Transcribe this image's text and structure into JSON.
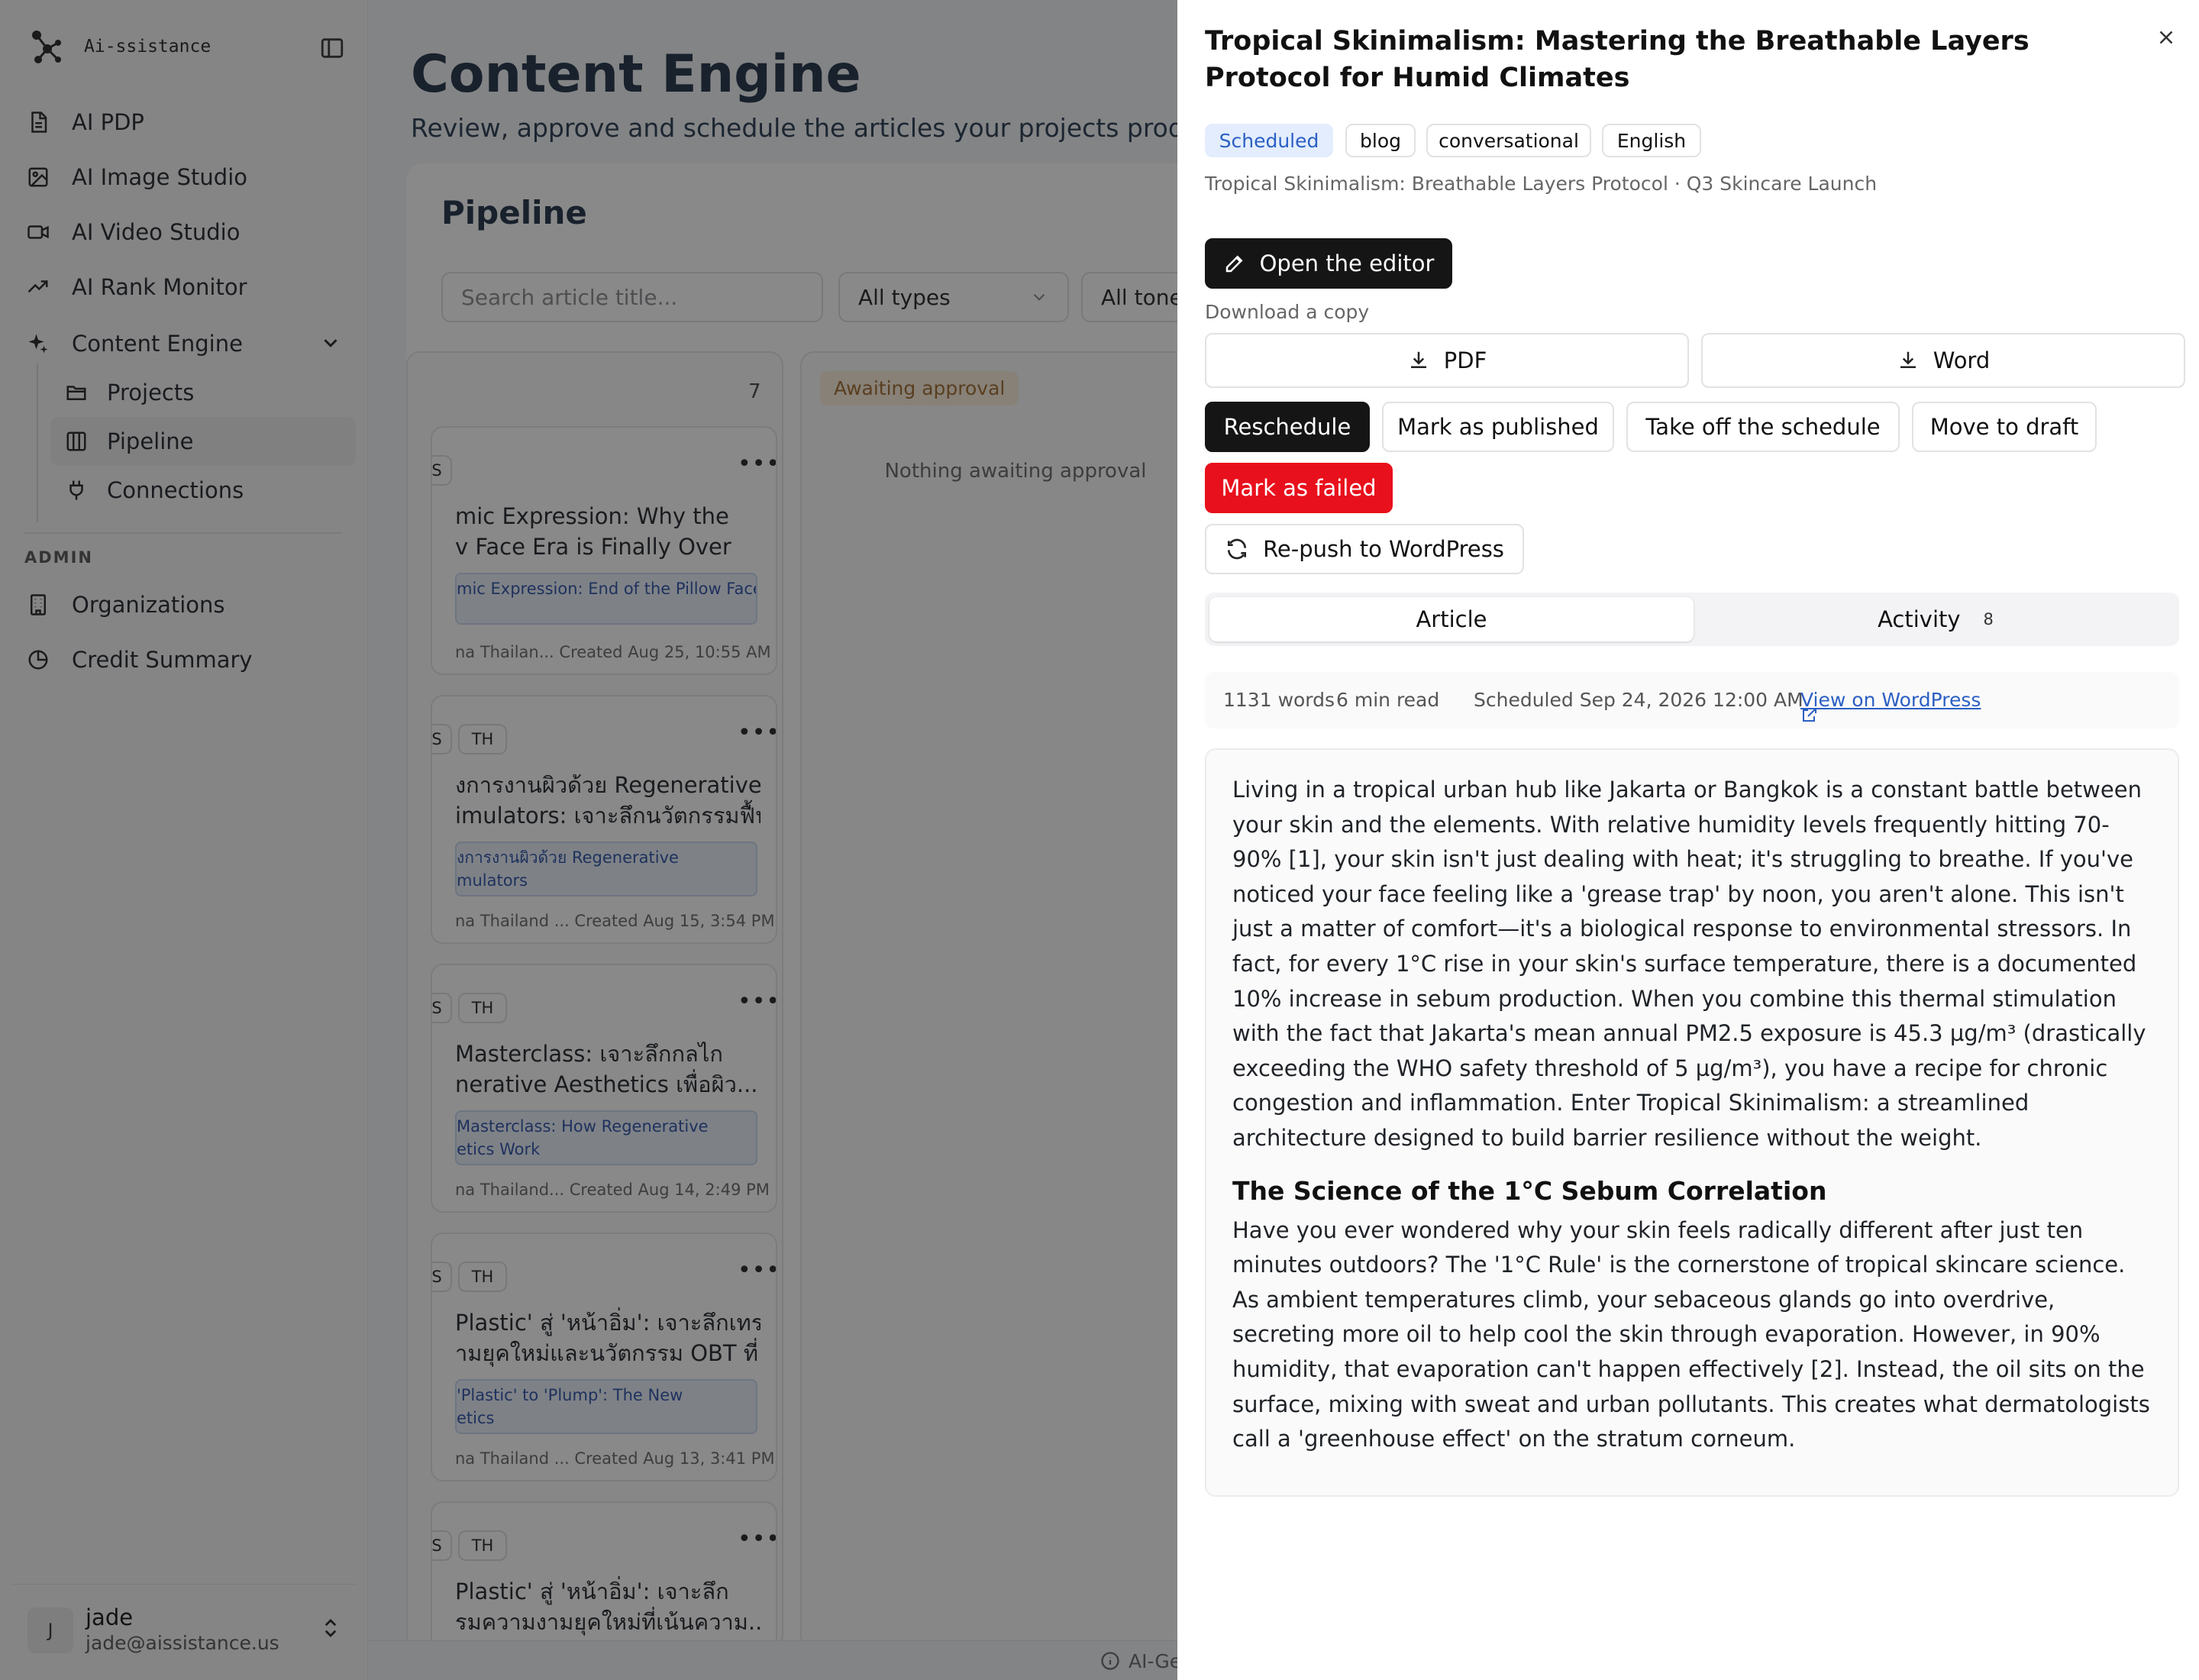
{
  "sidebar": {
    "brand": "Ai-ssistance",
    "nav": [
      {
        "label": "AI PDP",
        "icon": "document-icon"
      },
      {
        "label": "AI Image Studio",
        "icon": "image-icon"
      },
      {
        "label": "AI Video Studio",
        "icon": "video-icon"
      },
      {
        "label": "AI Rank Monitor",
        "icon": "trend-icon"
      },
      {
        "label": "Content Engine",
        "icon": "sparkle-icon"
      }
    ],
    "sub": [
      {
        "label": "Projects",
        "icon": "folder-icon"
      },
      {
        "label": "Pipeline",
        "icon": "columns-icon"
      },
      {
        "label": "Connections",
        "icon": "plug-icon"
      }
    ],
    "admin_label": "ADMIN",
    "admin": [
      {
        "label": "Organizations",
        "icon": "building-icon"
      },
      {
        "label": "Credit Summary",
        "icon": "pie-icon"
      }
    ],
    "user": {
      "initial": "J",
      "name": "jade",
      "email": "jade@aissistance.us"
    }
  },
  "main": {
    "title": "Content Engine",
    "subtitle": "Review, approve and schedule the articles your projects produce.",
    "pipeline_title": "Pipeline",
    "search_placeholder": "Search article title...",
    "type_filter": "All types",
    "tone_filter": "All tones",
    "column1_count": "7",
    "column2_label": "Awaiting approval",
    "column2_empty": "Nothing awaiting approval",
    "cards": [
      {
        "chip1": "S",
        "chip2": "",
        "title1": "mic Expression: Why the",
        "title2": "v Face Era is Finally Over",
        "proj1": "mic Expression: End of the Pillow Face",
        "proj2": "",
        "meta": "na Thailan...    Created Aug 25, 10:55 AM"
      },
      {
        "chip1": "S",
        "chip2": "TH",
        "title1": "งการงานผิวด้วย Regenerative",
        "title2": "imulators: เจาะลึกนวัตกรรมฟื้น...",
        "proj1": "งการงานผิวด้วย Regenerative",
        "proj2": "mulators",
        "meta": "na Thailand ...    Created Aug 15, 3:54 PM"
      },
      {
        "chip1": "S",
        "chip2": "TH",
        "title1": " Masterclass: เจาะลึกกลไก",
        "title2": "nerative Aesthetics เพื่อผิว...",
        "proj1": "Masterclass: How Regenerative",
        "proj2": "etics Work",
        "meta": "na Thailand...    Created Aug 14, 2:49 PM"
      },
      {
        "chip1": "S",
        "chip2": "TH",
        "title1": "Plastic' สู่ 'หน้าอิ่ม': เจาะลึกเทรนด์",
        "title2": "ามยุคใหม่และนวัตกรรม OBT ที่...",
        "proj1": "'Plastic' to 'Plump': The New",
        "proj2": "etics",
        "meta": "na Thailand ...    Created Aug 13, 3:41 PM"
      },
      {
        "chip1": "S",
        "chip2": "TH",
        "title1": "Plastic' สู่ 'หน้าอิ่ม': เจาะลึก",
        "title2": "รมความงามยุคใหม่ที่เน้นความ...",
        "proj1": "",
        "proj2": "",
        "meta": ""
      }
    ],
    "footer": "AI-Generated"
  },
  "drawer": {
    "title": "Tropical Skinimalism: Mastering the Breathable Layers Protocol for Humid Climates",
    "tags": [
      "Scheduled",
      "blog",
      "conversational",
      "English"
    ],
    "breadcrumb": "Tropical Skinimalism: Breathable Layers Protocol · Q3 Skincare Launch",
    "open_editor": "Open the editor",
    "download_label": "Download a copy",
    "pdf": "PDF",
    "word": "Word",
    "actions": {
      "reschedule": "Reschedule",
      "mark_published": "Mark as published",
      "take_off": "Take off the schedule",
      "move_draft": "Move to draft",
      "mark_failed": "Mark as failed",
      "repush": "Re-push to WordPress"
    },
    "tabs": {
      "article": "Article",
      "activity": "Activity",
      "activity_count": "8"
    },
    "stats": {
      "words": "1131 words",
      "read": "6 min read",
      "scheduled": "Scheduled Sep 24, 2026 12:00 AM",
      "view": "View on WordPress"
    },
    "article": {
      "p1": "Living in a tropical urban hub like Jakarta or Bangkok is a constant battle between your skin and the elements. With relative humidity levels frequently hitting 70-90% [1], your skin isn't just dealing with heat; it's struggling to breathe. If you've noticed your face feeling like a 'grease trap' by noon, you aren't alone. This isn't just a matter of comfort—it's a biological response to environmental stressors. In fact, for every 1°C rise in your skin's surface temperature, there is a documented 10% increase in sebum production. When you combine this thermal stimulation with the fact that Jakarta's mean annual PM2.5 exposure is 45.3 µg/m³ (drastically exceeding the WHO safety threshold of 5 µg/m³), you have a recipe for chronic congestion and inflammation. Enter Tropical Skinimalism: a streamlined architecture designed to build barrier resilience without the weight.",
      "h2": "The Science of the 1°C Sebum Correlation",
      "p2": "Have you ever wondered why your skin feels radically different after just ten minutes outdoors? The '1°C Rule' is the cornerstone of tropical skincare science. As ambient temperatures climb, your sebaceous glands go into overdrive, secreting more oil to help cool the skin through evaporation. However, in 90% humidity, that evaporation can't happen effectively [2]. Instead, the oil sits on the surface, mixing with sweat and urban pollutants. This creates what dermatologists call a 'greenhouse effect' on the stratum corneum."
    }
  }
}
